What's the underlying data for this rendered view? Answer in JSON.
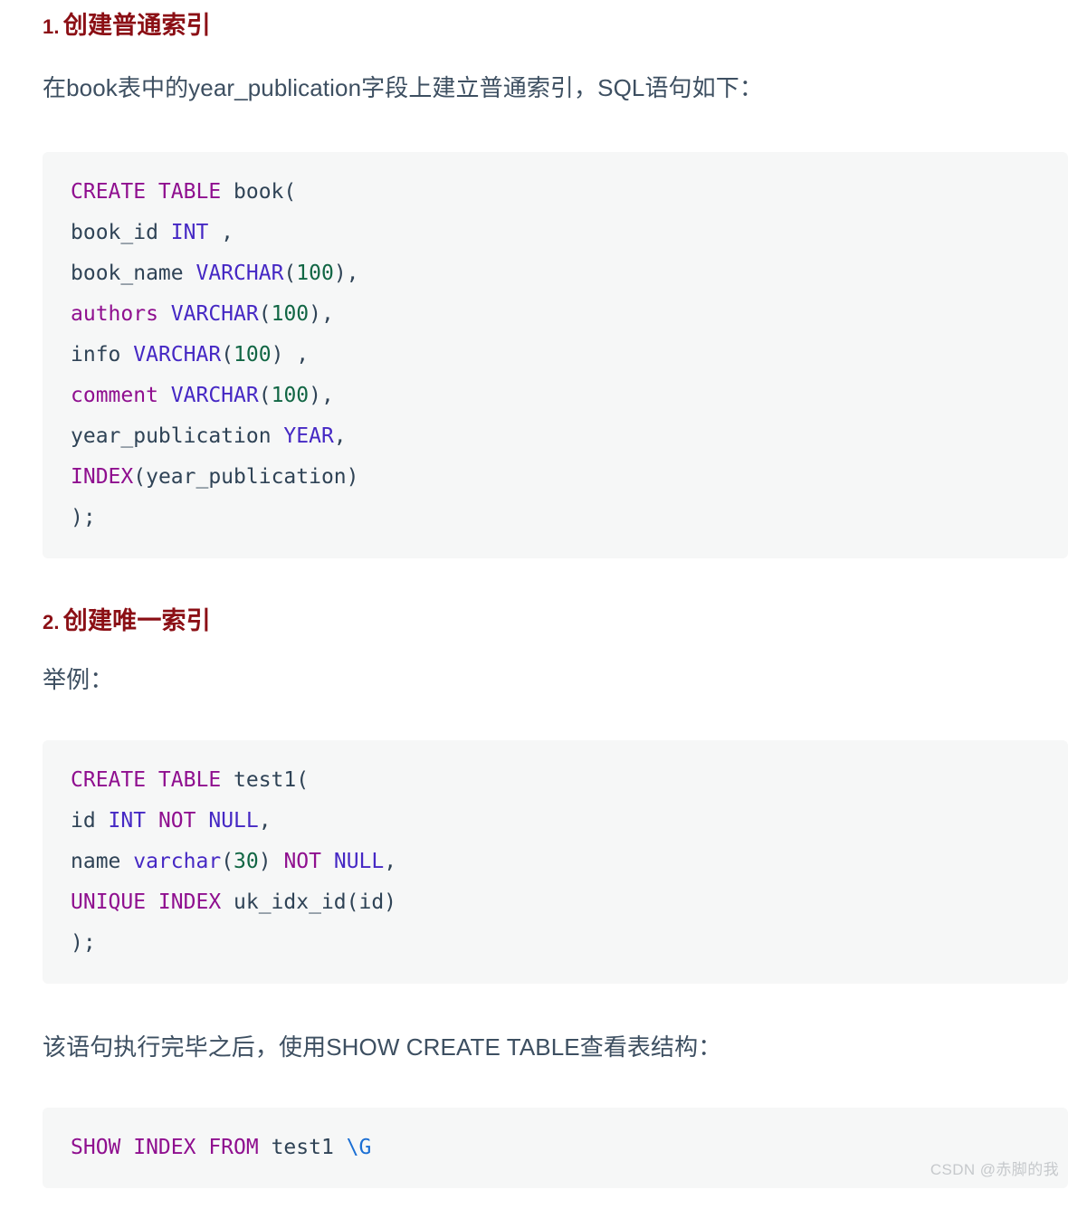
{
  "document": {
    "watermark": "CSDN @赤脚的我"
  },
  "sections": [
    {
      "number": "1.",
      "title": "创建普通索引",
      "paragraph": "在book表中的year_publication字段上建立普通索引，SQL语句如下：",
      "code_lines": [
        "CREATE TABLE book(",
        "book_id INT ,",
        "book_name VARCHAR(100),",
        "authors VARCHAR(100),",
        "info VARCHAR(100) ,",
        "comment VARCHAR(100),",
        "year_publication YEAR,",
        "INDEX(year_publication)",
        ");"
      ]
    },
    {
      "number": "2.",
      "title": "创建唯一索引",
      "paragraph": "举例：",
      "code_lines": [
        "CREATE TABLE test1(",
        "id INT NOT NULL,",
        "name varchar(30) NOT NULL,",
        "UNIQUE INDEX uk_idx_id(id)",
        ");"
      ],
      "paragraph_after": "该语句执行完毕之后，使用SHOW CREATE TABLE查看表结构：",
      "code_lines_after": [
        "SHOW INDEX FROM test1 \\G"
      ]
    }
  ],
  "colors": {
    "heading": "#8b0f15",
    "body_text": "#3d4f61",
    "code_background": "#f6f7f7",
    "keyword": "#8f0f8f",
    "type": "#4528c4",
    "number": "#116644",
    "plain": "#2f4356",
    "escape": "#1b6fd4",
    "watermark": "#c6c9cc",
    "page_background": "#ffffff"
  }
}
